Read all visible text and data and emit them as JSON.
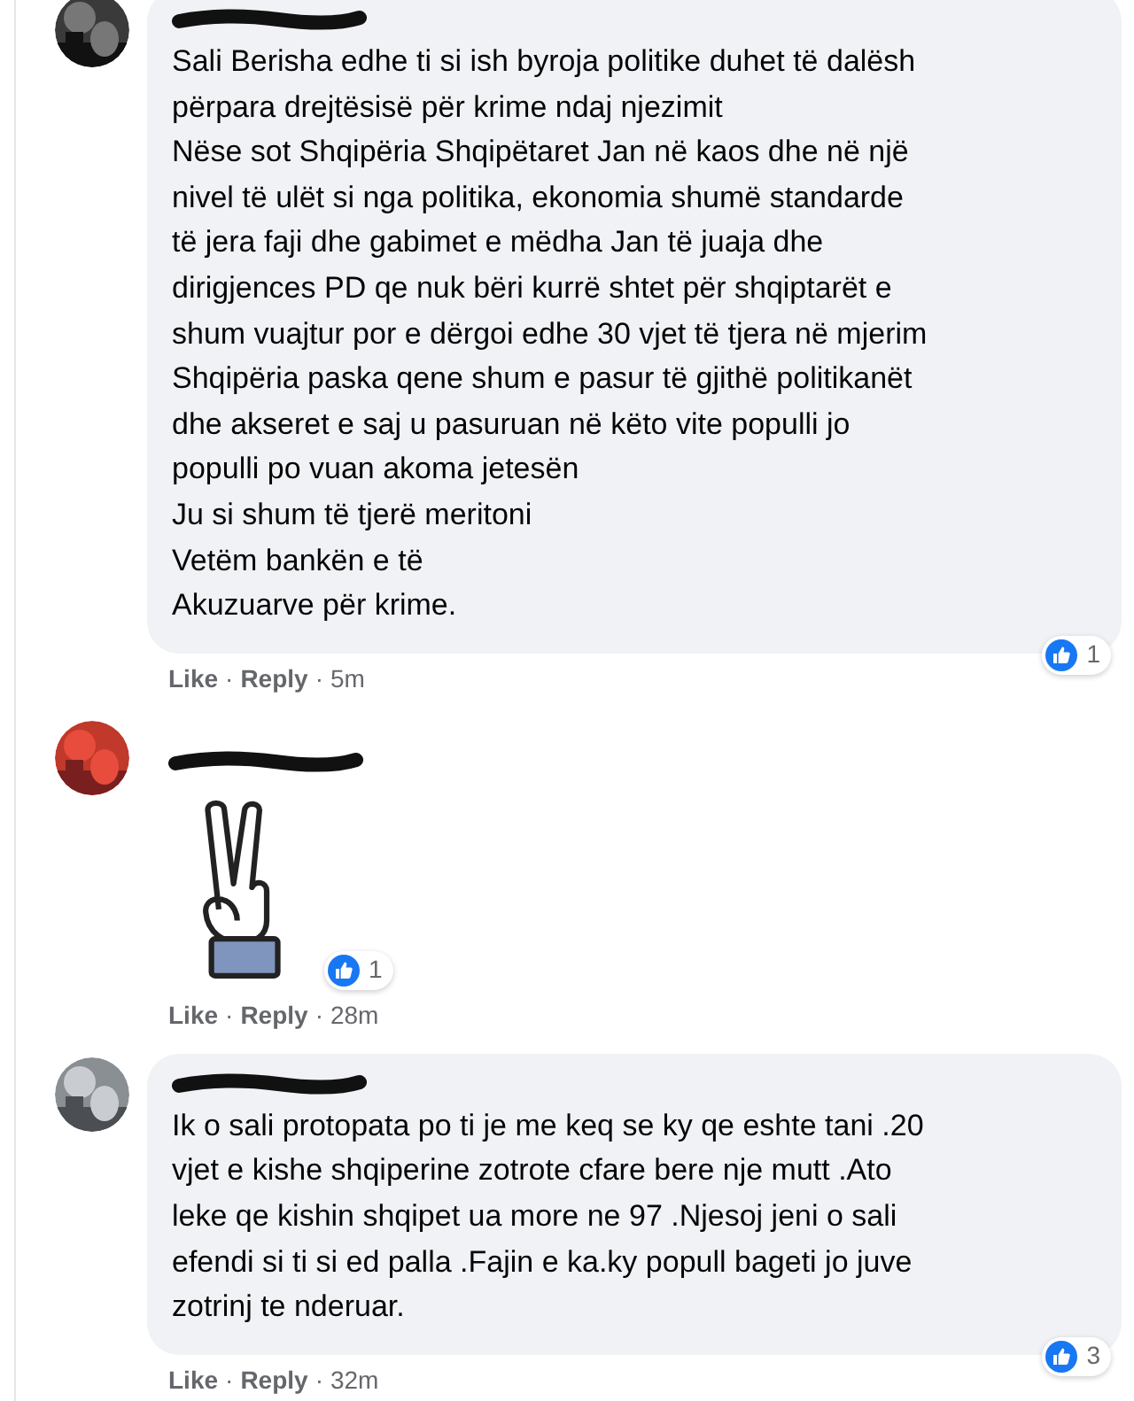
{
  "comments": [
    {
      "kind": "text",
      "name_redacted": true,
      "lines": [
        "Sali Berisha edhe ti si ish byroja politike duhet të dalësh",
        "përpara drejtësisë për krime ndaj njezimit",
        "Nëse sot Shqipëria Shqipëtaret Jan në kaos dhe në një",
        "nivel të ulët si nga politika, ekonomia shumë standarde",
        "të jera faji dhe gabimet e mëdha Jan të juaja dhe",
        "dirigjences PD qe nuk bëri kurrë shtet për shqiptarët e",
        "shum vuajtur por e dërgoi edhe 30 vjet të tjera në mjerim",
        "Shqipëria paska qene shum e pasur të gjithë politikanët",
        "dhe akseret e saj u pasuruan në këto vite populli jo",
        "populli po vuan akoma jetesën",
        "Ju si shum të tjerë meritoni",
        "Vetëm bankën e të",
        "Akuzuarve për krime."
      ],
      "reactions": "1",
      "like": "Like",
      "separators": [
        "·",
        "·"
      ],
      "reply": "Reply",
      "time": "5m"
    },
    {
      "kind": "sticker",
      "name_redacted": true,
      "reactions": "1",
      "like": "Like",
      "separators": [
        "·",
        "·"
      ],
      "reply": "Reply",
      "time": "28m"
    },
    {
      "kind": "text",
      "name_redacted": true,
      "lines": [
        "Ik o sali protopata po ti je me keq se ky qe eshte tani .20",
        "vjet e kishe shqiperine zotrote cfare bere nje mutt .Ato",
        "leke qe kishin shqipet ua more ne 97 .Njesoj jeni o sali",
        "efendi si ti si ed palla .Fajin e ka.ky popull bageti jo juve",
        "zotrinj te nderuar."
      ],
      "reactions": "3",
      "like": "Like",
      "separators": [
        "·",
        "·"
      ],
      "reply": "Reply",
      "time": "32m"
    }
  ]
}
